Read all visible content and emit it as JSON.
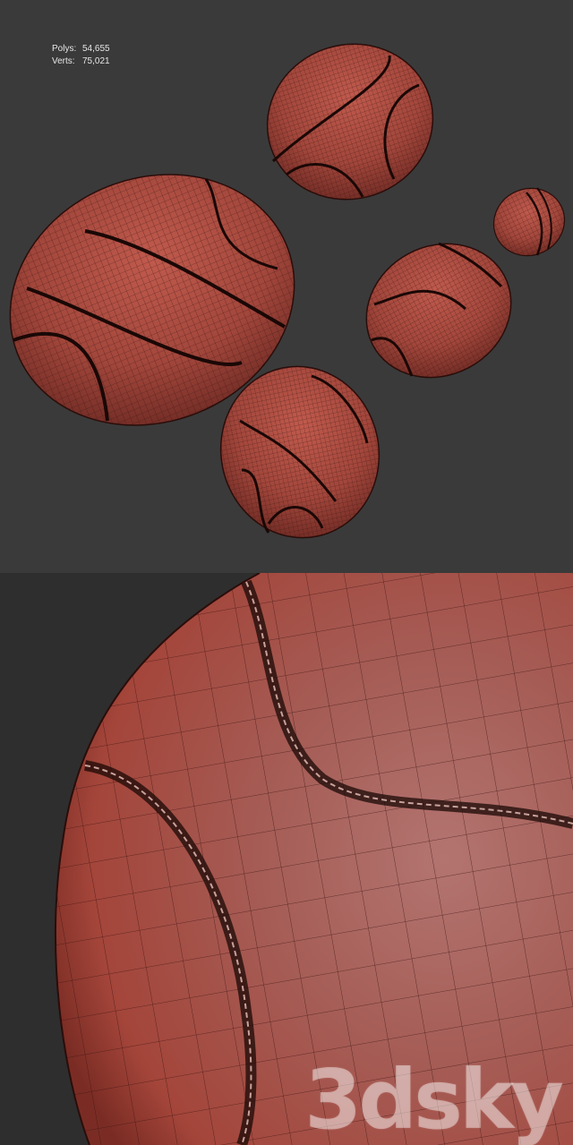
{
  "viewport_stats": {
    "polys_label": "Polys:",
    "polys_value": "54,655",
    "verts_label": "Verts:",
    "verts_value": "75,021"
  },
  "watermark": {
    "text": "3dsky"
  },
  "colors": {
    "viewport_top_background": "#3a3a3a",
    "viewport_bottom_background": "#2e2e2e",
    "stone_base": "#a2463b",
    "stone_highlight": "#c9786f",
    "wire": "#3a1411",
    "seam": "#1a0806"
  },
  "objects": [
    "pebble-large",
    "pebble-top",
    "pebble-medium",
    "pebble-small",
    "pebble-bottom"
  ]
}
